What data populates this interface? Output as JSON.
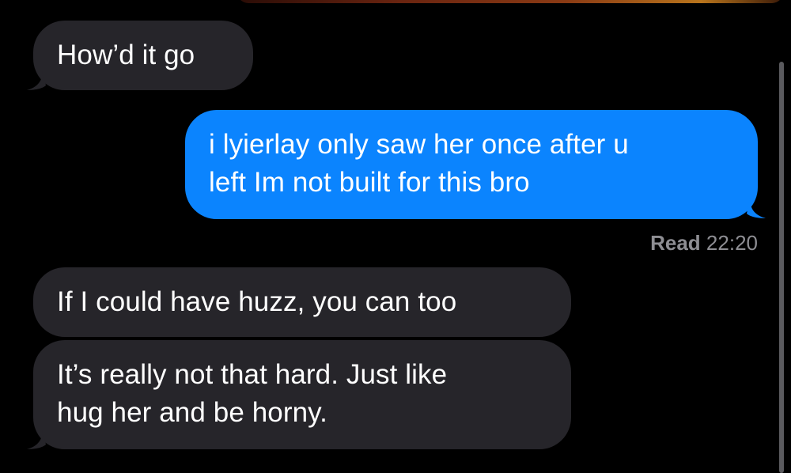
{
  "conversation": {
    "messages": [
      {
        "direction": "incoming",
        "text": "How’d it go"
      },
      {
        "direction": "outgoing",
        "text": "i lyierlay only saw her once after u\nleft Im not built for this bro"
      },
      {
        "direction": "incoming",
        "text": "If I could have huzz, you can too"
      },
      {
        "direction": "incoming",
        "text": "It’s really not that hard. Just like\nhug her and be horny."
      }
    ],
    "read_receipt": {
      "label": "Read",
      "time": "22:20"
    }
  },
  "colors": {
    "background": "#000000",
    "incoming_bubble": "#26252a",
    "outgoing_bubble": "#0b84fe",
    "receipt_text": "#8e8e93"
  }
}
